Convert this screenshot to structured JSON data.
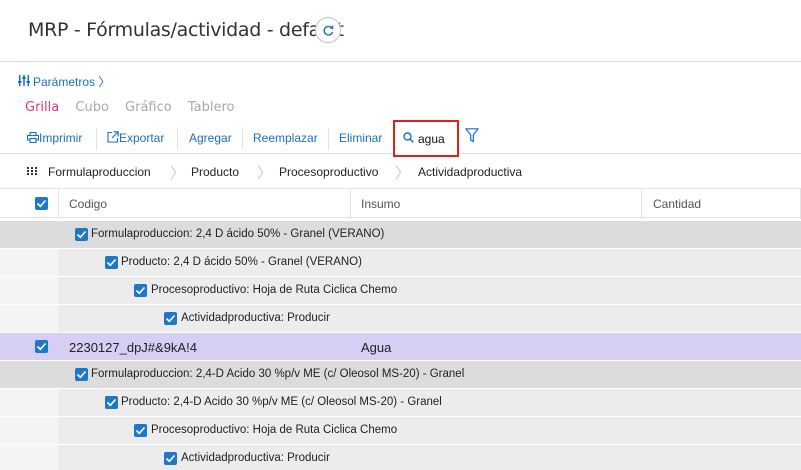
{
  "header": {
    "title": "MRP - Fórmulas/actividad - default",
    "refresh_icon": "refresh-icon"
  },
  "params": {
    "icon": "sliders-icon",
    "label": "Parámetros 〉"
  },
  "view_tabs": [
    {
      "label": "Grilla",
      "active": true
    },
    {
      "label": "Cubo",
      "active": false
    },
    {
      "label": "Gráfico",
      "active": false
    },
    {
      "label": "Tablero",
      "active": false
    }
  ],
  "toolbar": {
    "print": {
      "icon": "printer-icon",
      "label": "Imprimir"
    },
    "export": {
      "icon": "external-link-icon",
      "label": "Exportar"
    },
    "add": "Agregar",
    "replace": "Reemplazar",
    "delete": "Eliminar",
    "search": {
      "icon": "search-icon",
      "value": "agua"
    },
    "filter_icon": "filter-icon"
  },
  "breadcrumb": {
    "grip_icon": "grid-dots-icon",
    "items": [
      "Formulaproduccion",
      "Producto",
      "Procesoproductivo",
      "Actividadproductiva"
    ]
  },
  "grid": {
    "columns": [
      "Codigo",
      "Insumo",
      "Cantidad"
    ],
    "rows": [
      {
        "level": 0,
        "label": "Formulaproduccion: 2,4 D ácido 50% - Granel (VERANO)"
      },
      {
        "level": 1,
        "label": "Producto: 2,4 D ácido 50% - Granel (VERANO)"
      },
      {
        "level": 2,
        "label": "Procesoproductivo: Hoja de Ruta Ciclica Chemo"
      },
      {
        "level": 3,
        "label": "Actividadproductiva: Producir"
      },
      {
        "level": "data",
        "codigo": "2230127_dpJ#&9kA!4",
        "insumo": "Agua",
        "cantidad": ""
      },
      {
        "level": 0,
        "label": "Formulaproduccion: 2,4-D Acido 30 %p/v ME (c/ Oleosol MS-20) - Granel"
      },
      {
        "level": 1,
        "label": "Producto: 2,4-D Acido 30 %p/v ME (c/ Oleosol MS-20) - Granel"
      },
      {
        "level": 2,
        "label": "Procesoproductivo: Hoja de Ruta Ciclica Chemo"
      },
      {
        "level": 3,
        "label": "Actividadproductiva: Producir"
      }
    ]
  },
  "colors": {
    "accent": "#1a6fc4",
    "active_tab": "#e0377a",
    "selected_row": "#d6cef4",
    "highlight_border": "#e0201c"
  }
}
